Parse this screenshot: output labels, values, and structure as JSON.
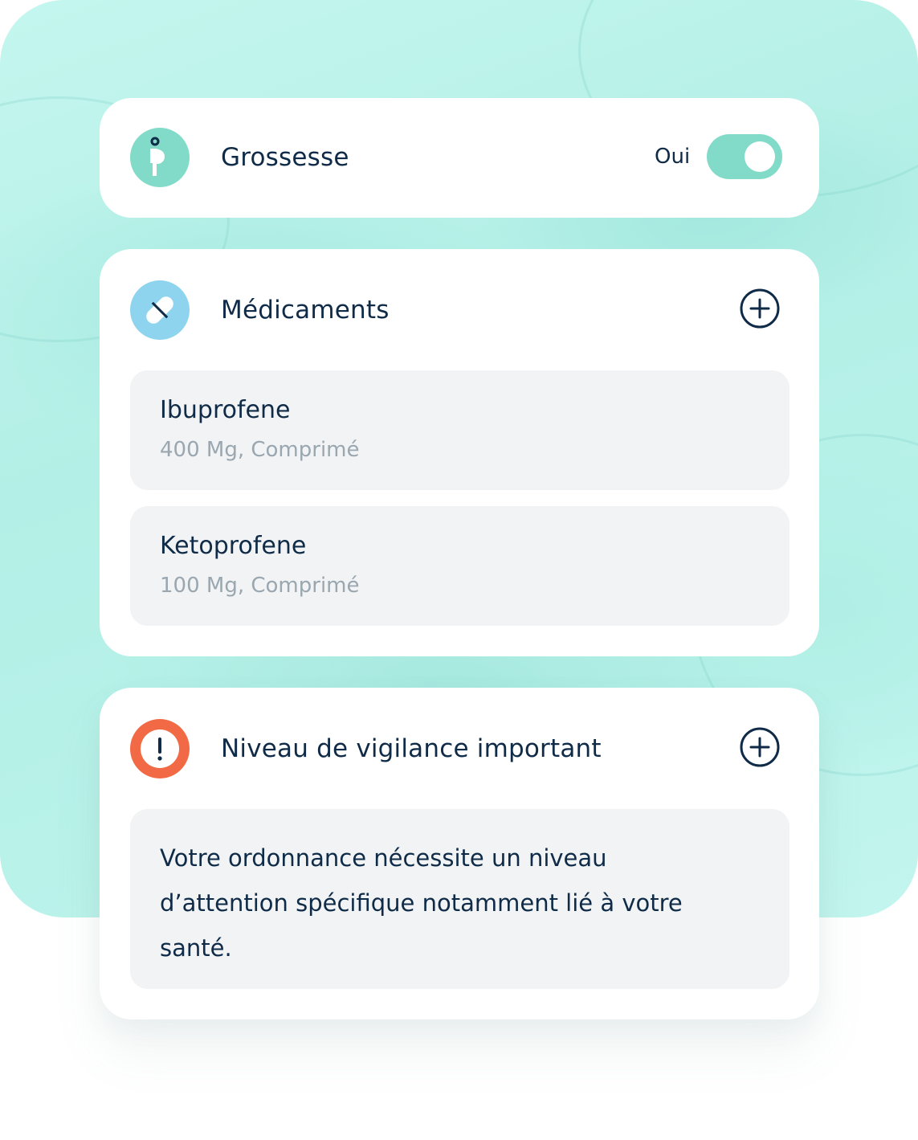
{
  "pregnancy": {
    "title": "Grossesse",
    "icon": "pregnancy-icon",
    "toggle_label": "Oui",
    "toggle_on": true
  },
  "medications": {
    "title": "Médicaments",
    "icon": "pill-icon",
    "add_icon": "plus-circle-icon",
    "items": [
      {
        "name": "Ibuprofene",
        "detail": "400 Mg, Comprimé"
      },
      {
        "name": "Ketoprofene",
        "detail": "100 Mg, Comprimé"
      }
    ]
  },
  "vigilance": {
    "title": "Niveau de vigilance important",
    "icon": "exclamation-icon",
    "add_icon": "plus-circle-icon",
    "message": "Votre ordonnance nécessite un niveau d’attention spécifique notamment lié à votre santé."
  },
  "colors": {
    "text": "#0f2b47",
    "muted": "#9aa7b0",
    "teal": "#82dbc8",
    "blue": "#8fd4ef",
    "orange": "#f26a45"
  }
}
